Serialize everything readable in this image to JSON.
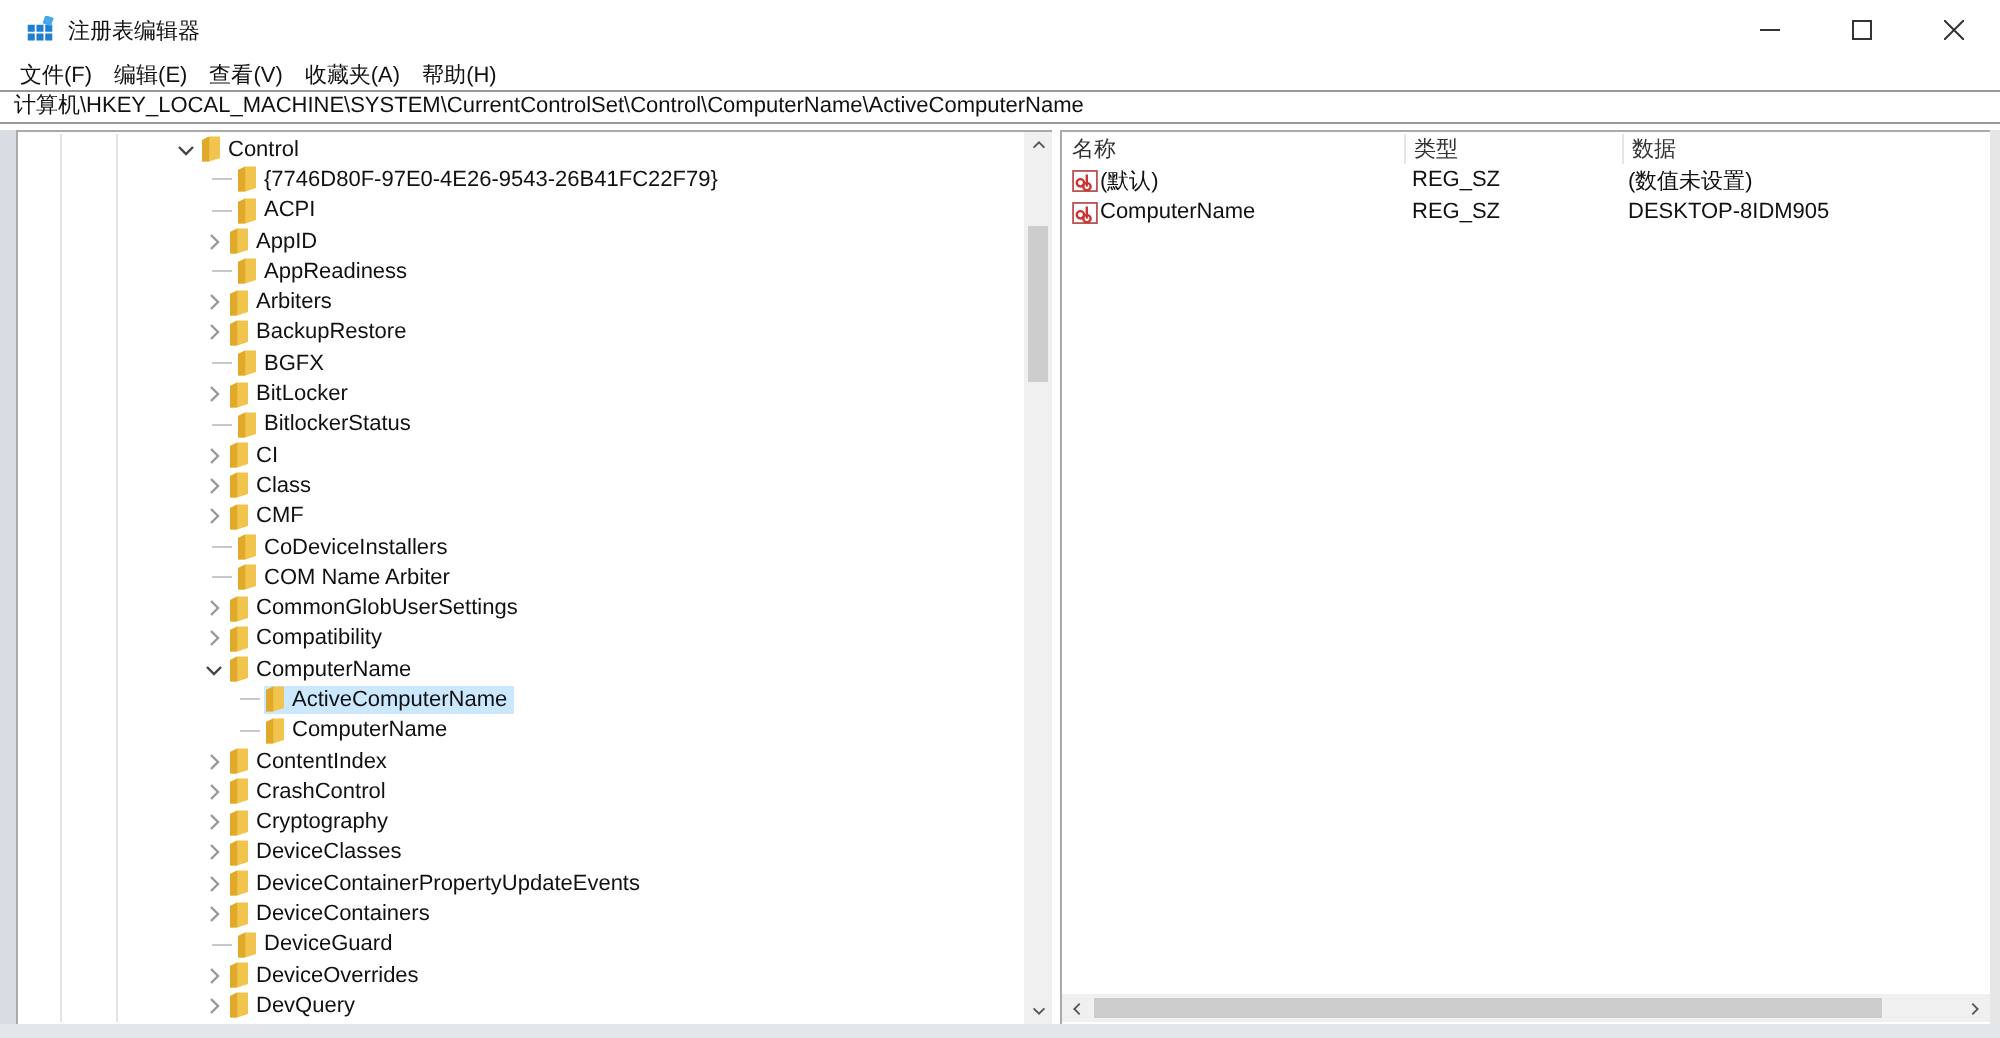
{
  "window": {
    "title": "注册表编辑器"
  },
  "menu": [
    {
      "label": "文件(F)"
    },
    {
      "label": "编辑(E)"
    },
    {
      "label": "查看(V)"
    },
    {
      "label": "收藏夹(A)"
    },
    {
      "label": "帮助(H)"
    }
  ],
  "address": {
    "value": "计算机\\HKEY_LOCAL_MACHINE\\SYSTEM\\CurrentControlSet\\Control\\ComputerName\\ActiveComputerName"
  },
  "tree": {
    "items": [
      {
        "label": "Control",
        "kind": "branch",
        "expanded": true,
        "selected": false,
        "children": [
          {
            "label": "{7746D80F-97E0-4E26-9543-26B41FC22F79}",
            "kind": "leaf",
            "selected": false
          },
          {
            "label": "ACPI",
            "kind": "leaf",
            "selected": false
          },
          {
            "label": "AppID",
            "kind": "branch",
            "expanded": false,
            "selected": false
          },
          {
            "label": "AppReadiness",
            "kind": "leaf",
            "selected": false
          },
          {
            "label": "Arbiters",
            "kind": "branch",
            "expanded": false,
            "selected": false
          },
          {
            "label": "BackupRestore",
            "kind": "branch",
            "expanded": false,
            "selected": false
          },
          {
            "label": "BGFX",
            "kind": "leaf",
            "selected": false
          },
          {
            "label": "BitLocker",
            "kind": "branch",
            "expanded": false,
            "selected": false
          },
          {
            "label": "BitlockerStatus",
            "kind": "leaf",
            "selected": false
          },
          {
            "label": "CI",
            "kind": "branch",
            "expanded": false,
            "selected": false
          },
          {
            "label": "Class",
            "kind": "branch",
            "expanded": false,
            "selected": false
          },
          {
            "label": "CMF",
            "kind": "branch",
            "expanded": false,
            "selected": false
          },
          {
            "label": "CoDeviceInstallers",
            "kind": "leaf",
            "selected": false
          },
          {
            "label": "COM Name Arbiter",
            "kind": "leaf",
            "selected": false
          },
          {
            "label": "CommonGlobUserSettings",
            "kind": "branch",
            "expanded": false,
            "selected": false
          },
          {
            "label": "Compatibility",
            "kind": "branch",
            "expanded": false,
            "selected": false
          },
          {
            "label": "ComputerName",
            "kind": "branch",
            "expanded": true,
            "selected": false,
            "children": [
              {
                "label": "ActiveComputerName",
                "kind": "leaf",
                "selected": true
              },
              {
                "label": "ComputerName",
                "kind": "leaf",
                "selected": false
              }
            ]
          },
          {
            "label": "ContentIndex",
            "kind": "branch",
            "expanded": false,
            "selected": false
          },
          {
            "label": "CrashControl",
            "kind": "branch",
            "expanded": false,
            "selected": false
          },
          {
            "label": "Cryptography",
            "kind": "branch",
            "expanded": false,
            "selected": false
          },
          {
            "label": "DeviceClasses",
            "kind": "branch",
            "expanded": false,
            "selected": false
          },
          {
            "label": "DeviceContainerPropertyUpdateEvents",
            "kind": "branch",
            "expanded": false,
            "selected": false
          },
          {
            "label": "DeviceContainers",
            "kind": "branch",
            "expanded": false,
            "selected": false
          },
          {
            "label": "DeviceGuard",
            "kind": "leaf",
            "selected": false
          },
          {
            "label": "DeviceOverrides",
            "kind": "branch",
            "expanded": false,
            "selected": false
          },
          {
            "label": "DevQuery",
            "kind": "branch",
            "expanded": false,
            "selected": false
          }
        ]
      }
    ]
  },
  "values": {
    "columns": [
      "名称",
      "类型",
      "数据"
    ],
    "rows": [
      {
        "name": "(默认)",
        "type": "REG_SZ",
        "data": "(数值未设置)"
      },
      {
        "name": "ComputerName",
        "type": "REG_SZ",
        "data": "DESKTOP-8IDM905"
      }
    ]
  }
}
